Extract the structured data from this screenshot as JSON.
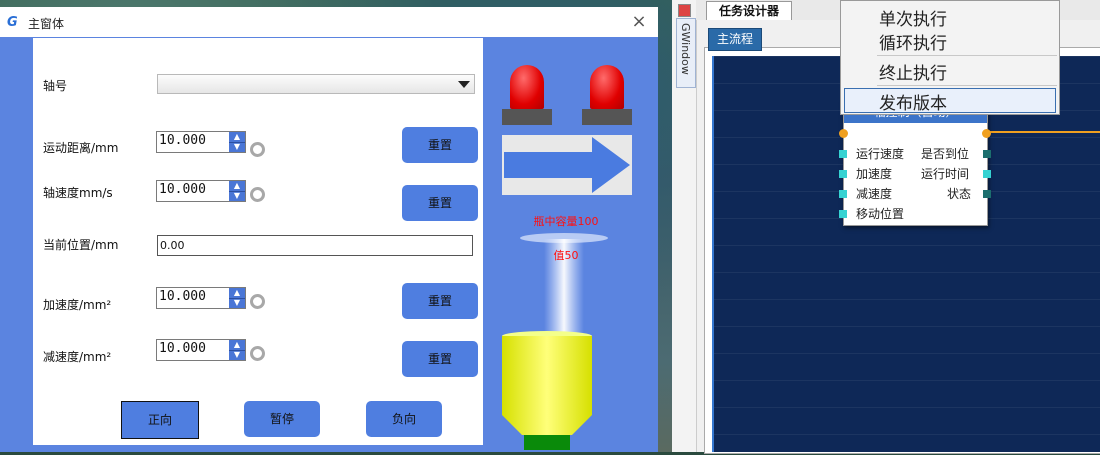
{
  "window": {
    "title": "主窗体",
    "close_glyph": "×"
  },
  "form": {
    "axis_label": "轴号",
    "axis_value": "",
    "distance_label": "运动距离/mm",
    "distance_value": "10.000",
    "speed_label": "轴速度mm/s",
    "speed_value": "10.000",
    "position_label": "当前位置/mm",
    "position_value": "0.00",
    "accel_label": "加速度/mm²",
    "accel_value": "10.000",
    "decel_label": "减速度/mm²",
    "decel_value": "10.000",
    "reset_label": "重置",
    "forward_label": "正向",
    "pause_label": "暂停",
    "reverse_label": "负向"
  },
  "indicator": {
    "capacity_text": "瓶中容量100",
    "value_text": "值50",
    "lamp_color": "#e00000",
    "liquid_color": "#e6f000",
    "arrow_color": "#4a7be0",
    "nozzle_color": "#0a8a0a"
  },
  "designer": {
    "side_tab": "GWindow",
    "task_tab": "任务设计器",
    "flow_tab": "主流程",
    "node_title": "轴控制（自动）",
    "inputs": [
      "运行速度",
      "加速度",
      "减速度",
      "移动位置"
    ],
    "outputs": [
      "是否到位",
      "运行时间",
      "状态"
    ],
    "canvas_color": "#0e2857"
  },
  "context_menu": {
    "items": [
      "单次执行",
      "循环执行",
      "终止执行",
      "发布版本"
    ]
  }
}
